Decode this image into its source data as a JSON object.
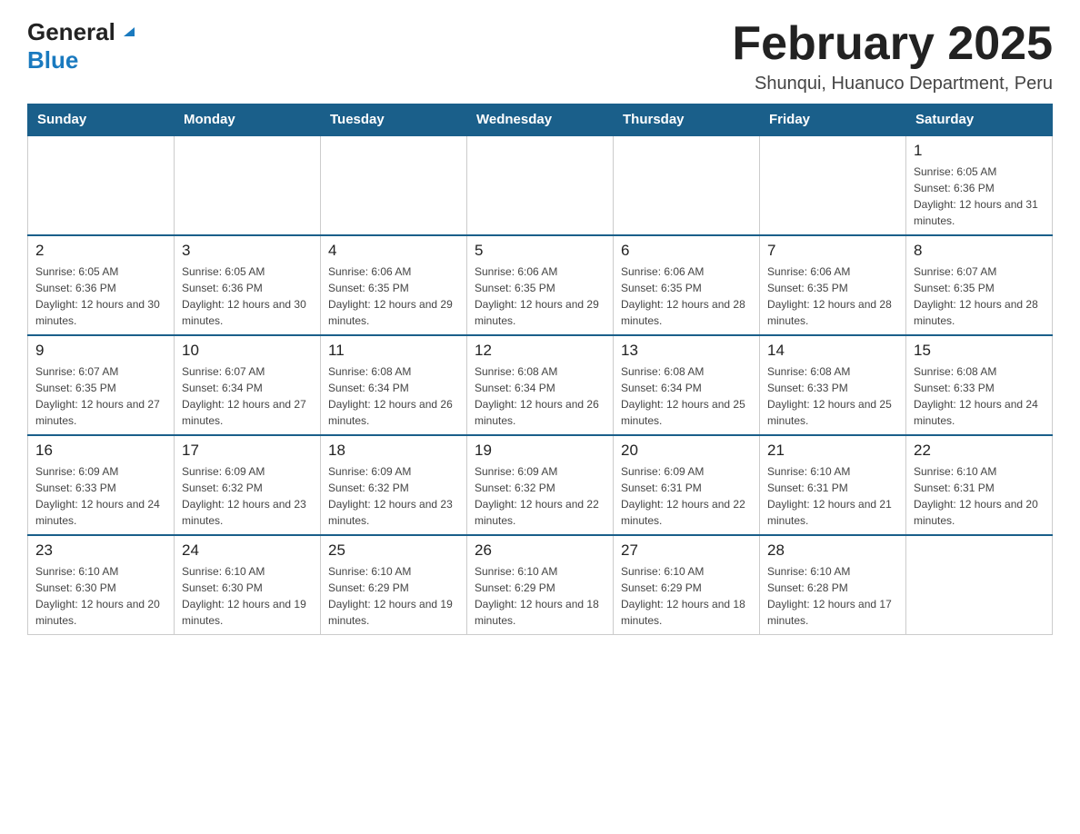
{
  "logo": {
    "general": "General",
    "blue": "Blue",
    "triangle": "▲"
  },
  "title": "February 2025",
  "location": "Shunqui, Huanuco Department, Peru",
  "days_of_week": [
    "Sunday",
    "Monday",
    "Tuesday",
    "Wednesday",
    "Thursday",
    "Friday",
    "Saturday"
  ],
  "weeks": [
    [
      {
        "day": "",
        "info": ""
      },
      {
        "day": "",
        "info": ""
      },
      {
        "day": "",
        "info": ""
      },
      {
        "day": "",
        "info": ""
      },
      {
        "day": "",
        "info": ""
      },
      {
        "day": "",
        "info": ""
      },
      {
        "day": "1",
        "info": "Sunrise: 6:05 AM\nSunset: 6:36 PM\nDaylight: 12 hours and 31 minutes."
      }
    ],
    [
      {
        "day": "2",
        "info": "Sunrise: 6:05 AM\nSunset: 6:36 PM\nDaylight: 12 hours and 30 minutes."
      },
      {
        "day": "3",
        "info": "Sunrise: 6:05 AM\nSunset: 6:36 PM\nDaylight: 12 hours and 30 minutes."
      },
      {
        "day": "4",
        "info": "Sunrise: 6:06 AM\nSunset: 6:35 PM\nDaylight: 12 hours and 29 minutes."
      },
      {
        "day": "5",
        "info": "Sunrise: 6:06 AM\nSunset: 6:35 PM\nDaylight: 12 hours and 29 minutes."
      },
      {
        "day": "6",
        "info": "Sunrise: 6:06 AM\nSunset: 6:35 PM\nDaylight: 12 hours and 28 minutes."
      },
      {
        "day": "7",
        "info": "Sunrise: 6:06 AM\nSunset: 6:35 PM\nDaylight: 12 hours and 28 minutes."
      },
      {
        "day": "8",
        "info": "Sunrise: 6:07 AM\nSunset: 6:35 PM\nDaylight: 12 hours and 28 minutes."
      }
    ],
    [
      {
        "day": "9",
        "info": "Sunrise: 6:07 AM\nSunset: 6:35 PM\nDaylight: 12 hours and 27 minutes."
      },
      {
        "day": "10",
        "info": "Sunrise: 6:07 AM\nSunset: 6:34 PM\nDaylight: 12 hours and 27 minutes."
      },
      {
        "day": "11",
        "info": "Sunrise: 6:08 AM\nSunset: 6:34 PM\nDaylight: 12 hours and 26 minutes."
      },
      {
        "day": "12",
        "info": "Sunrise: 6:08 AM\nSunset: 6:34 PM\nDaylight: 12 hours and 26 minutes."
      },
      {
        "day": "13",
        "info": "Sunrise: 6:08 AM\nSunset: 6:34 PM\nDaylight: 12 hours and 25 minutes."
      },
      {
        "day": "14",
        "info": "Sunrise: 6:08 AM\nSunset: 6:33 PM\nDaylight: 12 hours and 25 minutes."
      },
      {
        "day": "15",
        "info": "Sunrise: 6:08 AM\nSunset: 6:33 PM\nDaylight: 12 hours and 24 minutes."
      }
    ],
    [
      {
        "day": "16",
        "info": "Sunrise: 6:09 AM\nSunset: 6:33 PM\nDaylight: 12 hours and 24 minutes."
      },
      {
        "day": "17",
        "info": "Sunrise: 6:09 AM\nSunset: 6:32 PM\nDaylight: 12 hours and 23 minutes."
      },
      {
        "day": "18",
        "info": "Sunrise: 6:09 AM\nSunset: 6:32 PM\nDaylight: 12 hours and 23 minutes."
      },
      {
        "day": "19",
        "info": "Sunrise: 6:09 AM\nSunset: 6:32 PM\nDaylight: 12 hours and 22 minutes."
      },
      {
        "day": "20",
        "info": "Sunrise: 6:09 AM\nSunset: 6:31 PM\nDaylight: 12 hours and 22 minutes."
      },
      {
        "day": "21",
        "info": "Sunrise: 6:10 AM\nSunset: 6:31 PM\nDaylight: 12 hours and 21 minutes."
      },
      {
        "day": "22",
        "info": "Sunrise: 6:10 AM\nSunset: 6:31 PM\nDaylight: 12 hours and 20 minutes."
      }
    ],
    [
      {
        "day": "23",
        "info": "Sunrise: 6:10 AM\nSunset: 6:30 PM\nDaylight: 12 hours and 20 minutes."
      },
      {
        "day": "24",
        "info": "Sunrise: 6:10 AM\nSunset: 6:30 PM\nDaylight: 12 hours and 19 minutes."
      },
      {
        "day": "25",
        "info": "Sunrise: 6:10 AM\nSunset: 6:29 PM\nDaylight: 12 hours and 19 minutes."
      },
      {
        "day": "26",
        "info": "Sunrise: 6:10 AM\nSunset: 6:29 PM\nDaylight: 12 hours and 18 minutes."
      },
      {
        "day": "27",
        "info": "Sunrise: 6:10 AM\nSunset: 6:29 PM\nDaylight: 12 hours and 18 minutes."
      },
      {
        "day": "28",
        "info": "Sunrise: 6:10 AM\nSunset: 6:28 PM\nDaylight: 12 hours and 17 minutes."
      },
      {
        "day": "",
        "info": ""
      }
    ]
  ]
}
